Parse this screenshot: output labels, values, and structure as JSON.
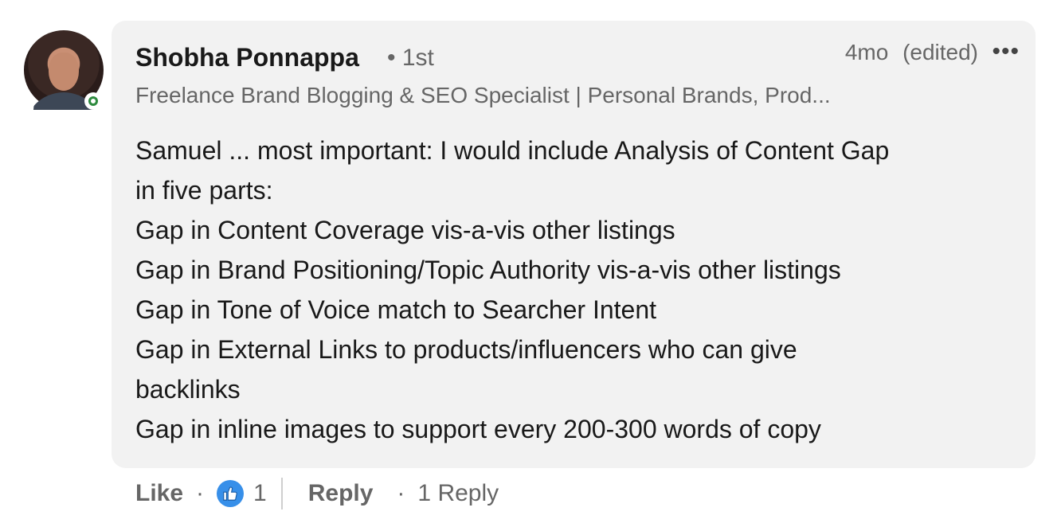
{
  "comment": {
    "author": {
      "name": "Shobha Ponnappa",
      "degree": "• 1st",
      "headline": "Freelance Brand Blogging & SEO Specialist | Personal Brands, Prod..."
    },
    "meta": {
      "time": "4mo",
      "edited": "(edited)",
      "more_icon": "more-horizontal-icon"
    },
    "body_lines": [
      "Samuel ... most important: I would include Analysis of Content Gap",
      "in five parts:",
      "Gap in Content Coverage vis-a-vis other listings",
      "Gap in Brand Positioning/Topic Authority vis-a-vis other listings",
      "Gap in Tone of Voice match to Searcher Intent",
      "Gap in External Links to products/influencers who can give",
      "backlinks",
      "Gap in inline images to support every 200-300 words of copy"
    ],
    "actions": {
      "like_label": "Like",
      "dot": "·",
      "reaction_icon": "like-thumb-icon",
      "reaction_count": "1",
      "reply_label": "Reply",
      "replies_label": "1 Reply"
    },
    "presence_status": "online",
    "colors": {
      "bubble": "#f2f2f2",
      "presence": "#2d8a3e",
      "like_reaction": "#378fe9"
    }
  }
}
